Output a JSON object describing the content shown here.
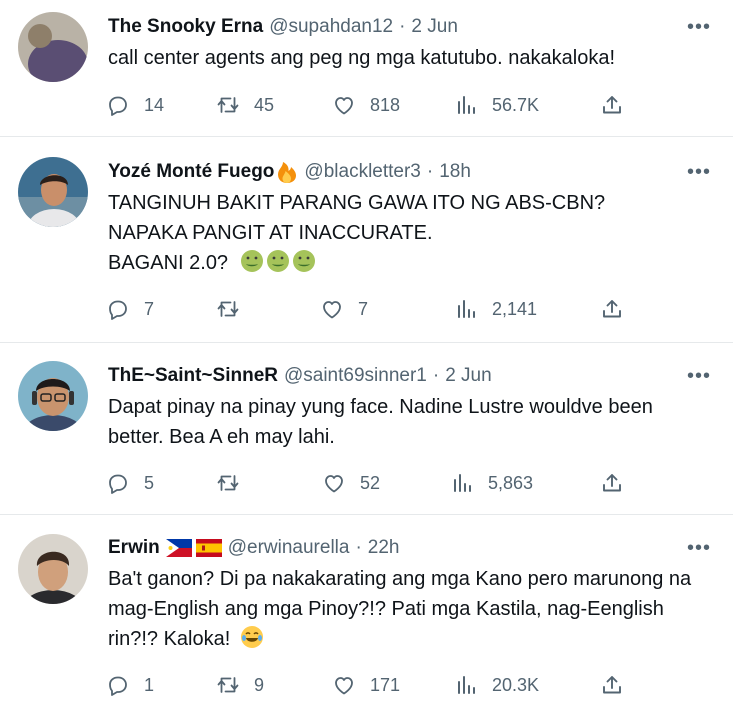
{
  "tweets": [
    {
      "name": "The Snooky Erna",
      "handle": "@supahdan12",
      "time": "2 Jun",
      "text": "call center agents ang peg ng mga katutubo. nakakaloka!",
      "replies": "14",
      "retweets": "45",
      "likes": "818",
      "views": "56.7K"
    },
    {
      "name": "Yozé Monté Fuego",
      "handle": "@blackletter3",
      "time": "18h",
      "text": "TANGINUH BAKIT PARANG GAWA ITO NG ABS-CBN?\nNAPAKA PANGIT AT INACCURATE.\nBAGANI 2.0?",
      "replies": "7",
      "retweets": "",
      "likes": "7",
      "views": "2,141"
    },
    {
      "name": "ThE~Saint~SinneR",
      "handle": "@saint69sinner1",
      "time": "2 Jun",
      "text": "Dapat pinay na pinay yung face. Nadine Lustre wouldve been better. Bea A eh may lahi.",
      "replies": "5",
      "retweets": "",
      "likes": "52",
      "views": "5,863"
    },
    {
      "name": "Erwin",
      "handle": "@erwinaurella",
      "time": "22h",
      "text": "Ba't ganon? Di pa nakakarating ang mga Kano pero marunong na mag-English ang mga Pinoy?!? Pati mga Kastila, nag-Eenglish rin?!? Kaloka!",
      "replies": "1",
      "retweets": "9",
      "likes": "171",
      "views": "20.3K"
    }
  ],
  "ui": {
    "separator": "·",
    "more": "•••",
    "colors": {
      "text": "#0f1419",
      "secondary": "#536471",
      "border": "#e6e9eb"
    }
  }
}
